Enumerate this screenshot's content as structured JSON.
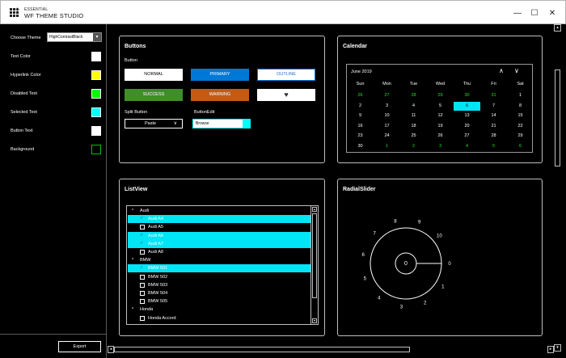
{
  "window": {
    "brand_top": "ESSENTIAL",
    "brand_main": "WF THEME STUDIO",
    "minimize": "—",
    "maximize": "☐",
    "close": "✕"
  },
  "sidebar": {
    "choose_theme_label": "Choose Theme",
    "theme_value": "HighContrastBlack",
    "settings": [
      {
        "label": "Text Color",
        "color": "#ffffff"
      },
      {
        "label": "Hyperlink Color",
        "color": "#ffff00"
      },
      {
        "label": "Disabled Text",
        "color": "#00ff00"
      },
      {
        "label": "Selected Text",
        "color": "#00ffff"
      },
      {
        "label": "Button Text",
        "color": "#ffffff"
      },
      {
        "label": "Background",
        "color": "#000000"
      }
    ],
    "export_label": "Export"
  },
  "buttons_panel": {
    "title": "Buttons",
    "button_section": "Button",
    "normal": "NORMAL",
    "primary": "PRIMARY",
    "outline": "OUTLINE",
    "success": "SUCCESS",
    "warning": "WARNING",
    "heart_icon": "♥",
    "split_label": "Split Button",
    "split_value": "Paste",
    "split_arrow": "∨",
    "edit_label": "ButtonEdit",
    "edit_value": "Browse"
  },
  "calendar": {
    "title": "Calendar",
    "month": "June 2019",
    "prev": "∧",
    "next": "∨",
    "days": [
      "Sun",
      "Mon",
      "Tue",
      "Wed",
      "Thu",
      "Fri",
      "Sat"
    ],
    "weeks": [
      [
        "26",
        "27",
        "28",
        "29",
        "30",
        "31",
        "1"
      ],
      [
        "2",
        "3",
        "4",
        "5",
        "6",
        "7",
        "8"
      ],
      [
        "9",
        "10",
        "11",
        "12",
        "13",
        "14",
        "15"
      ],
      [
        "16",
        "17",
        "18",
        "19",
        "20",
        "21",
        "22"
      ],
      [
        "23",
        "24",
        "25",
        "26",
        "27",
        "28",
        "29"
      ],
      [
        "30",
        "1",
        "2",
        "3",
        "4",
        "5",
        "6"
      ]
    ],
    "selected": "6"
  },
  "listview": {
    "title": "ListView",
    "rows": [
      {
        "type": "group",
        "text": "Audi"
      },
      {
        "type": "item",
        "text": "Audi A4",
        "checked": true
      },
      {
        "type": "item",
        "text": "Audi A5",
        "checked": false
      },
      {
        "type": "item",
        "text": "Audi A6",
        "checked": true
      },
      {
        "type": "item",
        "text": "Audi A7",
        "checked": true
      },
      {
        "type": "item",
        "text": "Audi A8",
        "checked": false
      },
      {
        "type": "group",
        "text": "BMW"
      },
      {
        "type": "item",
        "text": "BMW 501",
        "checked": true
      },
      {
        "type": "item",
        "text": "BMW 502",
        "checked": false
      },
      {
        "type": "item",
        "text": "BMW 503",
        "checked": false
      },
      {
        "type": "item",
        "text": "BMW 504",
        "checked": false
      },
      {
        "type": "item",
        "text": "BMW 505",
        "checked": false
      },
      {
        "type": "group",
        "text": "Honda"
      },
      {
        "type": "item",
        "text": "Honda Accord",
        "checked": false
      }
    ]
  },
  "radial": {
    "title": "RadialSlider",
    "value": "0",
    "ticks": [
      "0",
      "1",
      "2",
      "3",
      "4",
      "5",
      "6",
      "7",
      "8",
      "9",
      "10"
    ]
  }
}
